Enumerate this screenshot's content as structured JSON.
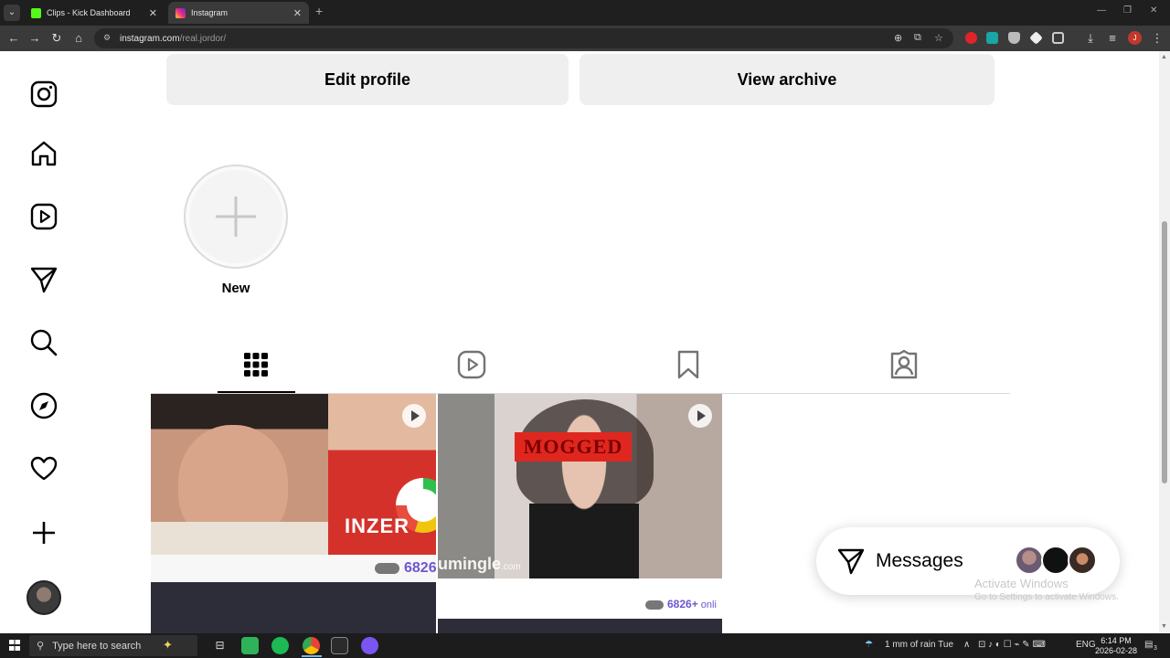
{
  "browser": {
    "tabs": [
      {
        "title": "Clips - Kick Dashboard",
        "favicon_color": "#53fc18",
        "active": false
      },
      {
        "title": "Instagram",
        "favicon_color": "#e1306c",
        "active": true
      }
    ],
    "new_tab_icon": "plus-icon",
    "url_host": "instagram.com",
    "url_path": "/real.jordor/",
    "profile_initial": "J"
  },
  "profile": {
    "edit_profile_label": "Edit profile",
    "view_archive_label": "View archive",
    "new_highlight_label": "New"
  },
  "sidebar": {
    "items": [
      {
        "name": "instagram-logo-icon"
      },
      {
        "name": "home-icon"
      },
      {
        "name": "reels-icon"
      },
      {
        "name": "messages-icon"
      },
      {
        "name": "search-icon"
      },
      {
        "name": "explore-icon"
      },
      {
        "name": "notifications-icon"
      },
      {
        "name": "create-icon"
      }
    ]
  },
  "profile_tabs": [
    {
      "name": "posts-grid-icon",
      "active": true
    },
    {
      "name": "reels-tab-icon",
      "active": false
    },
    {
      "name": "saved-icon",
      "active": false
    },
    {
      "name": "tagged-icon",
      "active": false
    }
  ],
  "posts": {
    "tile1_text": "INZER",
    "tile1_counter": "6826",
    "tile2_stamp": "MOGGED",
    "tile2_watermark": "umingle",
    "tile2_watermark_suffix": ".com",
    "tile2_counter": "6826+",
    "tile2_counter_suffix": " onli"
  },
  "messages": {
    "label": "Messages"
  },
  "watermark": {
    "title": "Activate Windows",
    "subtitle": "Go to Settings to activate Windows."
  },
  "taskbar": {
    "search_placeholder": "Type here to search",
    "weather": "1 mm of rain Tue",
    "language": "ENG",
    "time": "6:14 PM",
    "date": "2026-02-28",
    "notification_count": "3"
  }
}
